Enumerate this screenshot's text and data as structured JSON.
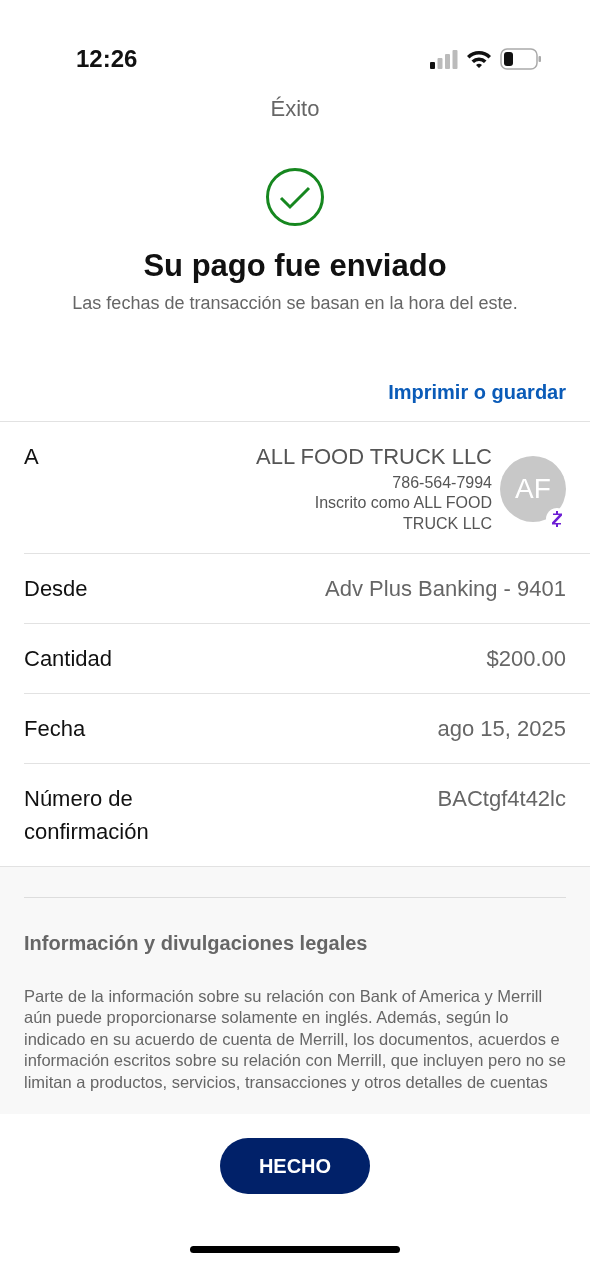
{
  "status_bar": {
    "time": "12:26"
  },
  "header": {
    "title": "Éxito"
  },
  "confirmation": {
    "heading": "Su pago fue enviado",
    "note": "Las fechas de transacción se basan en la hora del este."
  },
  "print_link": "Imprimir o guardar",
  "details": [
    {
      "kind": "payee",
      "label": "A",
      "name": "ALL FOOD TRUCK LLC",
      "phone": "786-564-7994",
      "registered": "Inscrito como ALL FOOD TRUCK LLC",
      "avatar": "AF"
    },
    {
      "kind": "plain",
      "label": "Desde",
      "value": "Adv Plus Banking - 9401"
    },
    {
      "kind": "plain",
      "label": "Cantidad",
      "value": "$200.00"
    },
    {
      "kind": "plain",
      "label": "Fecha",
      "value": "ago 15, 2025"
    },
    {
      "kind": "plain",
      "label": "Número de confirmación",
      "value": "BACtgf4t42lc"
    }
  ],
  "legal": {
    "title": "Información y divulgaciones legales",
    "text": "Parte de la información sobre su relación con Bank of America y Merrill aún puede proporcionarse solamente en inglés. Además, según lo indicado en su acuerdo de cuenta de Merrill, los documentos, acuerdos e información escritos sobre su relación con Merrill, que incluyen pero no se limitan a productos, servicios, transacciones y otros detalles de cuentas"
  },
  "done_button": "HECHO"
}
